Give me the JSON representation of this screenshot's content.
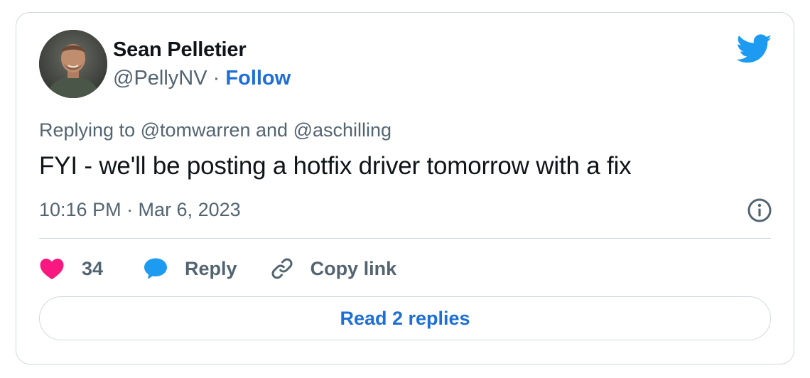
{
  "author": {
    "name": "Sean Pelletier",
    "handle": "@PellyNV",
    "separator": "·",
    "follow_label": "Follow"
  },
  "reply_context": {
    "text": "Replying to @tomwarren and @aschilling"
  },
  "tweet": {
    "text": "FYI - we'll be posting a hotfix driver tomorrow with a fix",
    "timestamp": "10:16 PM · Mar 6, 2023"
  },
  "actions": {
    "like_count": "34",
    "reply_label": "Reply",
    "copy_link_label": "Copy link"
  },
  "read_replies_label": "Read 2 replies",
  "icons": {
    "brand": "twitter-bird-icon",
    "info": "info-icon",
    "like": "heart-icon",
    "reply": "speech-bubble-icon",
    "copy": "link-icon"
  },
  "colors": {
    "accent": "#1d6fd6",
    "bird": "#1d9bf0",
    "heart": "#f91880",
    "muted_text": "#536471",
    "border": "#cfd9de"
  }
}
